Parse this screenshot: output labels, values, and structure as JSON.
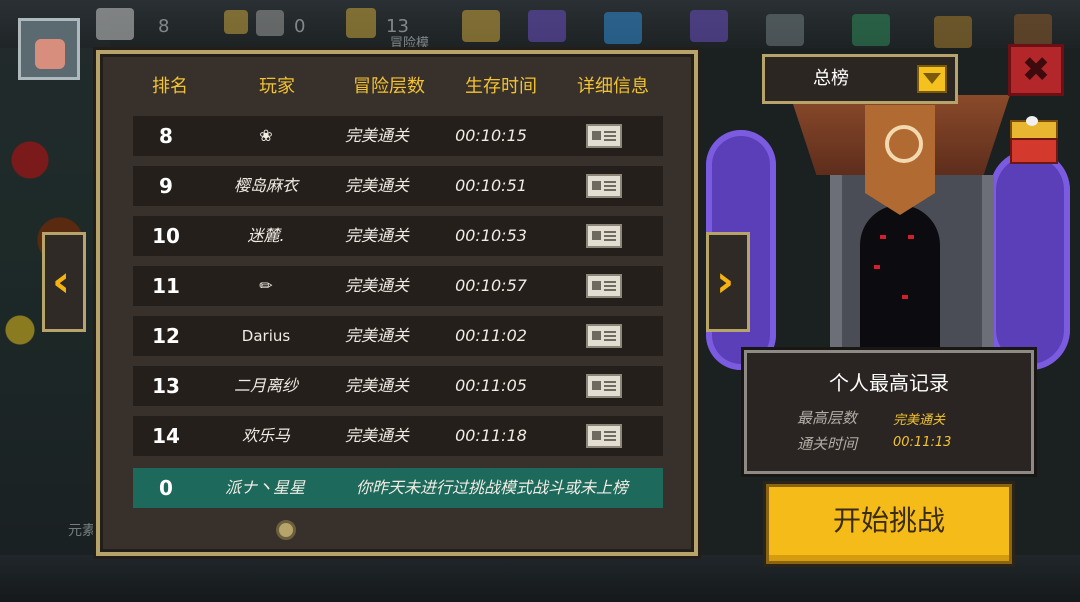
{
  "hud": {
    "count_1": "8",
    "count_2": "0",
    "count_3": "13",
    "mode_hint": "冒险模"
  },
  "side_label": "元素",
  "leaderboard": {
    "headers": {
      "rank": "排名",
      "player": "玩家",
      "floors": "冒险层数",
      "time": "生存时间",
      "details": "详细信息"
    },
    "rows": [
      {
        "rank": "8",
        "player": "❀",
        "floors": "完美通关",
        "time": "00:10:15"
      },
      {
        "rank": "9",
        "player": "樱岛麻衣",
        "floors": "完美通关",
        "time": "00:10:51"
      },
      {
        "rank": "10",
        "player": "迷麓.",
        "floors": "完美通关",
        "time": "00:10:53"
      },
      {
        "rank": "11",
        "player": "✏",
        "floors": "完美通关",
        "time": "00:10:57"
      },
      {
        "rank": "12",
        "player": "Darius",
        "floors": "完美通关",
        "time": "00:11:02"
      },
      {
        "rank": "13",
        "player": "二月离纱",
        "floors": "完美通关",
        "time": "00:11:05"
      },
      {
        "rank": "14",
        "player": "欢乐马",
        "floors": "完美通关",
        "time": "00:11:18"
      }
    ],
    "self_row": {
      "rank": "0",
      "player": "派ナ丶星星",
      "note": "你昨天未进行过挑战模式战斗或未上榜"
    }
  },
  "nav": {
    "prev_glyph": "‹",
    "next_glyph": "›"
  },
  "dropdown": {
    "selected": "总榜"
  },
  "close_glyph": "✖",
  "personal_record": {
    "title": "个人最高记录",
    "max_floor_label": "最高层数",
    "max_floor_value": "完美通关",
    "clear_time_label": "通关时间",
    "clear_time_value": "00:11:13"
  },
  "start_button": {
    "label": "开始挑战"
  },
  "colors": {
    "accent_gold": "#f2c233",
    "panel_bg": "#37302b",
    "panel_border": "#b7a46b",
    "self_row_bg": "#1d6a5c",
    "start_button": "#f5bb18"
  }
}
